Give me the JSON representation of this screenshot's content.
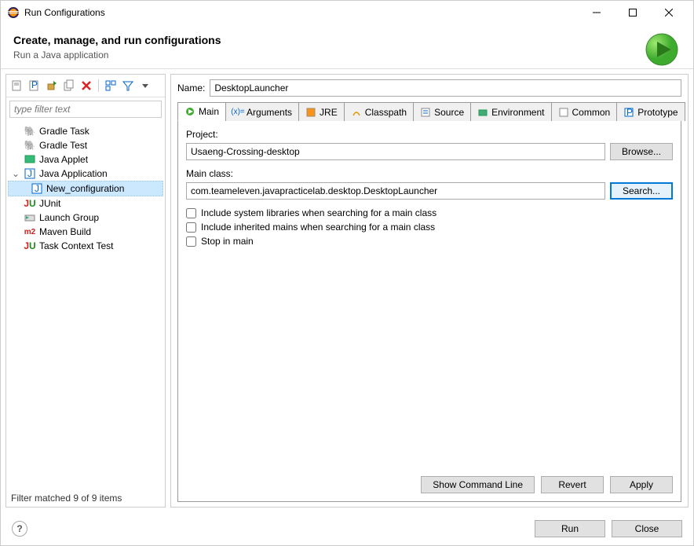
{
  "window": {
    "title": "Run Configurations"
  },
  "header": {
    "title": "Create, manage, and run configurations",
    "subtitle": "Run a Java application"
  },
  "filter": {
    "placeholder": "type filter text"
  },
  "tree": {
    "items": [
      {
        "label": "Gradle Task",
        "icon": "elephant"
      },
      {
        "label": "Gradle Test",
        "icon": "elephant"
      },
      {
        "label": "Java Applet",
        "icon": "applet"
      },
      {
        "label": "Java Application",
        "icon": "java",
        "expanded": true,
        "children": [
          {
            "label": "New_configuration",
            "icon": "java",
            "selected": true
          }
        ]
      },
      {
        "label": "JUnit",
        "icon": "junit"
      },
      {
        "label": "Launch Group",
        "icon": "group"
      },
      {
        "label": "Maven Build",
        "icon": "maven"
      },
      {
        "label": "Task Context Test",
        "icon": "junit"
      }
    ]
  },
  "status": "Filter matched 9 of 9 items",
  "name_field": {
    "label": "Name:",
    "value": "DesktopLauncher"
  },
  "tabs": [
    {
      "label": "Main",
      "icon": "play"
    },
    {
      "label": "Arguments",
      "icon": "args"
    },
    {
      "label": "JRE",
      "icon": "jre"
    },
    {
      "label": "Classpath",
      "icon": "classpath"
    },
    {
      "label": "Source",
      "icon": "source"
    },
    {
      "label": "Environment",
      "icon": "env"
    },
    {
      "label": "Common",
      "icon": "common"
    },
    {
      "label": "Prototype",
      "icon": "proto"
    }
  ],
  "main_tab": {
    "project_label": "Project:",
    "project_value": "Usaeng-Crossing-desktop",
    "browse_label": "Browse...",
    "main_class_label": "Main class:",
    "main_class_value": "com.teameleven.javapracticelab.desktop.DesktopLauncher",
    "search_label": "Search...",
    "cb_system": "Include system libraries when searching for a main class",
    "cb_inherited": "Include inherited mains when searching for a main class",
    "cb_stop": "Stop in main"
  },
  "actions": {
    "show_cmd": "Show Command Line",
    "revert": "Revert",
    "apply": "Apply"
  },
  "footer": {
    "run": "Run",
    "close": "Close"
  }
}
